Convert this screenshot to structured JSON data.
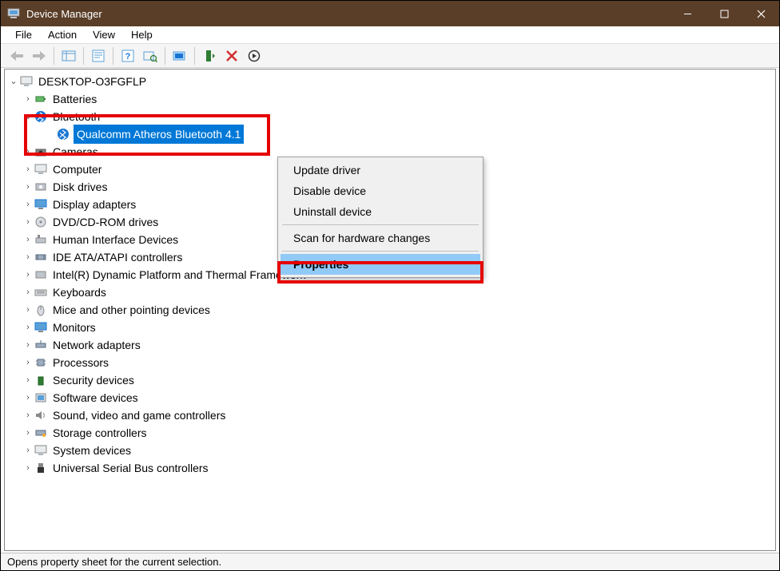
{
  "title": "Device Manager",
  "menu": {
    "file": "File",
    "action": "Action",
    "view": "View",
    "help": "Help"
  },
  "computer_name": "DESKTOP-O3FGFLP",
  "categories": {
    "batteries": "Batteries",
    "bluetooth": "Bluetooth",
    "bluetooth_device": "Qualcomm Atheros Bluetooth 4.1",
    "cameras": "Cameras",
    "computer": "Computer",
    "diskdrives": "Disk drives",
    "display": "Display adapters",
    "dvdrom": "DVD/CD-ROM drives",
    "hid": "Human Interface Devices",
    "ide": "IDE ATA/ATAPI controllers",
    "intel_dptf": "Intel(R) Dynamic Platform and Thermal Framework",
    "keyboards": "Keyboards",
    "mice": "Mice and other pointing devices",
    "monitors": "Monitors",
    "network": "Network adapters",
    "processors": "Processors",
    "security": "Security devices",
    "software": "Software devices",
    "sound": "Sound, video and game controllers",
    "storage": "Storage controllers",
    "system": "System devices",
    "usb": "Universal Serial Bus controllers"
  },
  "context_menu": {
    "update": "Update driver",
    "disable": "Disable device",
    "uninstall": "Uninstall device",
    "scan": "Scan for hardware changes",
    "properties": "Properties"
  },
  "statusbar": "Opens property sheet for the current selection."
}
